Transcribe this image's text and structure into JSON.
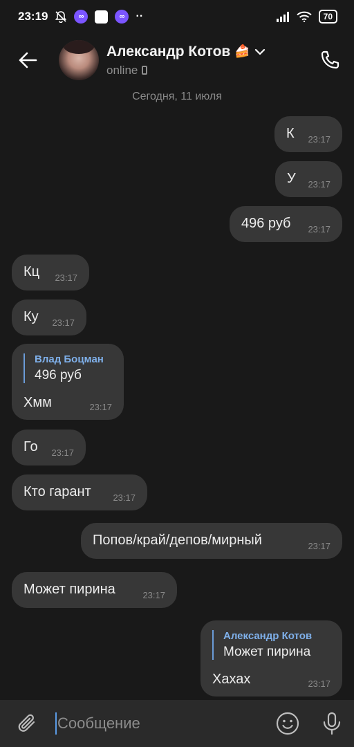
{
  "status": {
    "time": "23:19",
    "battery": "70"
  },
  "header": {
    "name": "Александр Котов",
    "name_emoji": "🍰",
    "status": "online"
  },
  "date_separator": "Сегодня, 11 июля",
  "messages": [
    {
      "side": "out",
      "text": "К",
      "time": "23:17"
    },
    {
      "side": "out",
      "text": "У",
      "time": "23:17"
    },
    {
      "side": "out",
      "text": "496 руб",
      "time": "23:17"
    },
    {
      "side": "in",
      "text": "Кц",
      "time": "23:17"
    },
    {
      "side": "in",
      "text": "Ку",
      "time": "23:17"
    },
    {
      "side": "in",
      "reply_author": "Влад Боцман",
      "reply_text": "496 руб",
      "text": "Хмм",
      "time": "23:17"
    },
    {
      "side": "in",
      "text": "Го",
      "time": "23:17"
    },
    {
      "side": "in",
      "text": "Кто гарант",
      "time": "23:17"
    },
    {
      "side": "out",
      "text": "Попов/край/депов/мирный",
      "time": "23:17"
    },
    {
      "side": "in",
      "text": "Может пирина",
      "time": "23:17"
    },
    {
      "side": "out",
      "reply_author": "Александр Котов",
      "reply_text": "Может пирина",
      "text": "Хахах",
      "time": "23:17"
    }
  ],
  "composer": {
    "placeholder": "Сообщение"
  }
}
